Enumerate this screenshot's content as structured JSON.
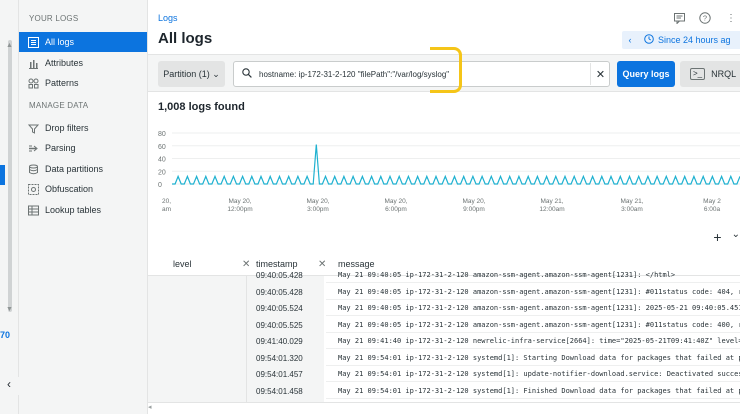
{
  "sidebar": {
    "section_logs": "YOUR LOGS",
    "section_manage": "MANAGE DATA",
    "items": [
      {
        "label": "All logs",
        "icon": "list-icon"
      },
      {
        "label": "Attributes",
        "icon": "bar-chart-icon"
      },
      {
        "label": "Patterns",
        "icon": "patterns-icon"
      }
    ],
    "manage_items": [
      {
        "label": "Drop filters",
        "icon": "filter-icon"
      },
      {
        "label": "Parsing",
        "icon": "parsing-icon"
      },
      {
        "label": "Data partitions",
        "icon": "database-icon"
      },
      {
        "label": "Obfuscation",
        "icon": "obfuscation-icon"
      },
      {
        "label": "Lookup tables",
        "icon": "table-icon"
      }
    ],
    "rail_number": "70"
  },
  "header": {
    "breadcrumb": "Logs",
    "title": "All logs",
    "time_range": "Since 24 hours ag"
  },
  "query": {
    "partition_label": "Partition (1) ⌄",
    "search_value": "hostname: ip-172-31-2-120 \"filePath\":\"/var/log/syslog\"",
    "query_button": "Query logs",
    "nrql_button": "NRQL"
  },
  "results": {
    "count_text": "1,008 logs found"
  },
  "chart_data": {
    "type": "line",
    "y_ticks": [
      "80",
      "60",
      "40",
      "20",
      "0"
    ],
    "ylim": [
      0,
      80
    ],
    "x_ticks": [
      {
        "l1": "20,",
        "l2": "am"
      },
      {
        "l1": "May 20,",
        "l2": "12:00pm"
      },
      {
        "l1": "May 20,",
        "l2": "3:00pm"
      },
      {
        "l1": "May 20,",
        "l2": "6:00pm"
      },
      {
        "l1": "May 20,",
        "l2": "9:00pm"
      },
      {
        "l1": "May 21,",
        "l2": "12:00am"
      },
      {
        "l1": "May 21,",
        "l2": "3:00am"
      },
      {
        "l1": "May 2",
        "l2": "6:00a"
      }
    ],
    "color": "#1fb1d0",
    "series": [
      {
        "values": [
          0,
          0,
          12,
          0,
          0,
          12,
          0,
          0,
          12,
          0,
          0,
          12,
          0,
          0,
          12,
          0,
          0,
          12,
          0,
          0,
          12,
          0,
          0,
          12,
          0,
          0,
          12,
          0,
          0,
          12,
          0,
          0,
          12,
          0,
          0,
          12,
          0,
          0,
          12,
          0,
          0,
          12,
          0,
          0,
          12,
          0,
          0,
          62,
          0,
          0,
          12,
          0,
          0,
          12,
          0,
          0,
          12,
          0,
          0,
          12,
          0,
          0,
          12,
          0,
          0,
          12,
          0,
          0,
          12,
          0,
          0,
          12,
          0,
          0,
          12,
          0,
          0,
          12,
          0,
          0,
          12,
          0,
          0,
          12,
          0,
          0,
          12,
          0,
          0,
          12,
          0,
          0,
          12,
          0,
          0,
          12,
          0,
          0,
          12,
          0,
          0,
          12,
          0,
          0,
          12,
          0,
          0,
          12,
          0,
          0,
          12,
          0,
          0,
          12,
          0,
          0,
          12,
          0,
          0,
          12,
          0,
          0,
          12,
          0,
          0,
          12,
          0,
          0,
          12,
          0,
          0,
          12,
          0,
          0,
          12,
          0,
          0,
          12,
          0,
          0,
          12,
          0,
          0,
          12,
          0,
          0,
          12,
          0,
          0,
          12,
          0,
          0,
          12,
          0,
          0,
          12,
          0,
          0,
          12,
          0,
          0,
          12,
          0,
          0,
          12,
          0,
          0,
          12,
          0,
          0,
          12,
          0,
          0,
          12,
          0,
          0,
          12,
          0,
          0,
          12,
          0,
          0,
          12,
          0,
          0,
          12
        ]
      }
    ]
  },
  "table": {
    "columns": {
      "level": "level",
      "timestamp": "timestamp",
      "message": "message"
    },
    "rows": [
      {
        "ts": "09:40:05.428",
        "msg": "May 21 09:40:05 ip-172-31-2-120 amazon-ssm-agent.amazon-ssm-agent[1231]: </html>"
      },
      {
        "ts": "09:40:05.428",
        "msg": "May 21 09:40:05 ip-172-31-2-120 amazon-ssm-agent.amazon-ssm-agent[1231]: #011status code: 404, r"
      },
      {
        "ts": "09:40:05.524",
        "msg": "May 21 09:40:05 ip-172-31-2-120 amazon-ssm-agent.amazon-ssm-agent[1231]: 2025-05-21 09:40:05.451"
      },
      {
        "ts": "09:40:05.525",
        "msg": "May 21 09:40:05 ip-172-31-2-120 amazon-ssm-agent.amazon-ssm-agent[1231]: #011status code: 400, r"
      },
      {
        "ts": "09:41:40.029",
        "msg": "May 21 09:41:40 ip-172-31-2-120 newrelic-infra-service[2664]: time=\"2025-05-21T09:41:40Z\" level="
      },
      {
        "ts": "09:54:01.320",
        "msg": "May 21 09:54:01 ip-172-31-2-120 systemd[1]: Starting Download data for packages that failed at p"
      },
      {
        "ts": "09:54:01.457",
        "msg": "May 21 09:54:01 ip-172-31-2-120 systemd[1]: update-notifier-download.service: Deactivated succes"
      },
      {
        "ts": "09:54:01.458",
        "msg": "May 21 09:54:01 ip-172-31-2-120 systemd[1]: Finished Download data for packages that failed at p"
      }
    ]
  }
}
